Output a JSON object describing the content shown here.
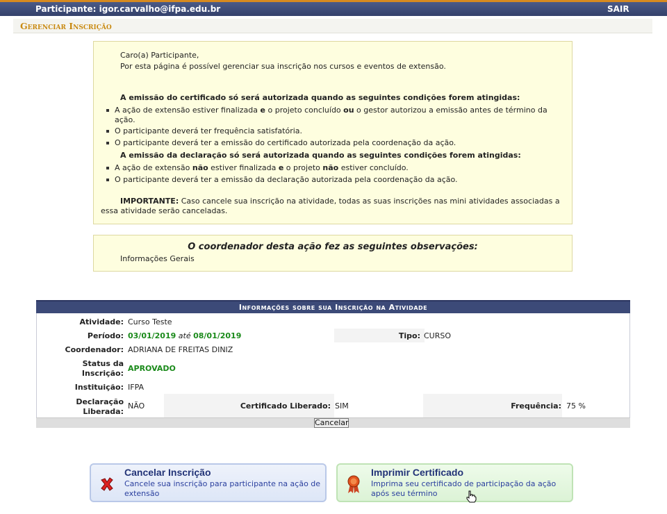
{
  "header": {
    "participant_label": "Participante: igor.carvalho@ifpa.edu.br",
    "logout": "SAIR"
  },
  "page_title": "Gerenciar Inscrição",
  "notice": {
    "greeting": "Caro(a) Participante,",
    "intro": "Por esta página é possível gerenciar sua inscrição nos cursos e eventos de extensão.",
    "cert_heading": "A emissão do certificado só será autorizada quando as seguintes condições forem atingidas:",
    "cert_item1_a": "A ação de extensão estiver finalizada ",
    "cert_item1_e": "e",
    "cert_item1_b": " o projeto concluído ",
    "cert_item1_ou": "ou",
    "cert_item1_c": " o gestor autorizou a emissão antes de término da ação.",
    "cert_item2": "O participante deverá ter frequência satisfatória.",
    "cert_item3": "O participante deverá ter a emissão do certificado autorizada pela coordenação da ação.",
    "decl_heading": "A emissão da declaração só será autorizada quando as seguintes condições forem atingidas:",
    "decl_item1_a": "A ação de extensão ",
    "decl_item1_nao1": "não",
    "decl_item1_b": " estiver finalizada ",
    "decl_item1_e": "e",
    "decl_item1_c": " o projeto ",
    "decl_item1_nao2": "não",
    "decl_item1_d": " estiver concluído.",
    "decl_item2": "O participante deverá ter a emissão da declaração autorizada pela coordenação da ação.",
    "important_label": "IMPORTANTE:",
    "important_text": " Caso cancele sua inscrição na atividade, todas as suas inscrições nas mini atividades associadas a essa atividade serão canceladas."
  },
  "observations": {
    "title": "O coordenador desta ação fez as seguintes observações:",
    "text": "Informações Gerais"
  },
  "info": {
    "caption": "Informações sobre sua Inscrição na Atividade",
    "atividade_label": "Atividade:",
    "atividade": "Curso Teste",
    "periodo_label": "Período:",
    "periodo_inicio": "03/01/2019",
    "periodo_ate": "até",
    "periodo_fim": "08/01/2019",
    "tipo_label": "Tipo:",
    "tipo": "CURSO",
    "coordenador_label": "Coordenador:",
    "coordenador": "ADRIANA DE FREITAS DINIZ",
    "status_label_1": "Status da",
    "status_label_2": "Inscrição:",
    "status": "APROVADO",
    "instituicao_label": "Instituição:",
    "instituicao": "IFPA",
    "declaracao_label_1": "Declaração",
    "declaracao_label_2": "Liberada:",
    "declaracao": "NÃO",
    "certificado_label": "Certificado Liberado:",
    "certificado": "SIM",
    "frequencia_label": "Frequência:",
    "frequencia": "75 %",
    "cancel_button": "Cancelar"
  },
  "actions": {
    "cancel_title": "Cancelar Inscrição",
    "cancel_desc": "Cancele sua inscrição para participante na ação de extensão",
    "print_title": "Imprimir Certificado",
    "print_desc": "Imprima seu certificado de participação da ação após seu término",
    "cancel_icon": "red-x-icon",
    "print_icon": "award-ribbon-icon"
  },
  "colors": {
    "header_bg": "#3c4a78",
    "accent_orange": "#d78a1f",
    "notice_bg": "#fefedf",
    "approved_green": "#1a8a1a"
  }
}
